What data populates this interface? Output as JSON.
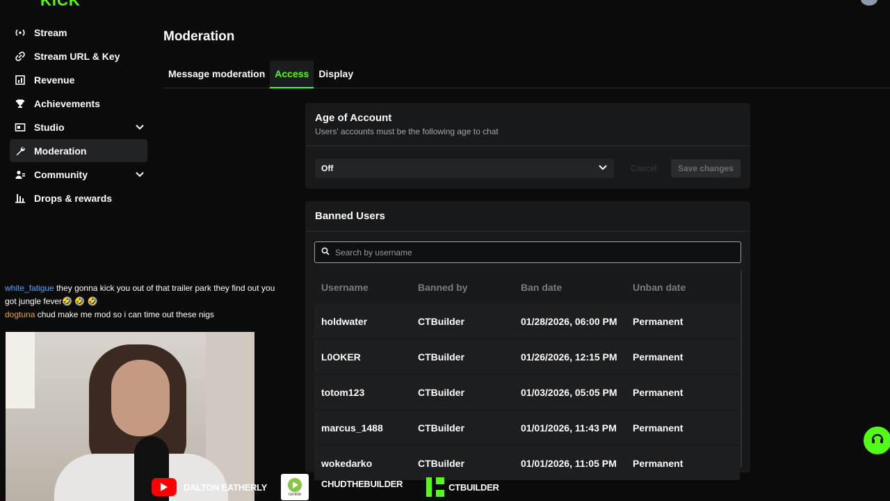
{
  "brand": {
    "logo_text": "KICK",
    "accent_color": "#53fc18"
  },
  "sidebar": {
    "items": [
      {
        "label": "Stream",
        "icon": "broadcast-icon"
      },
      {
        "label": "Stream URL & Key",
        "icon": "link-icon"
      },
      {
        "label": "Revenue",
        "icon": "chart-icon"
      },
      {
        "label": "Achievements",
        "icon": "trophy-icon"
      },
      {
        "label": "Studio",
        "icon": "studio-icon",
        "expandable": true
      },
      {
        "label": "Moderation",
        "icon": "wrench-icon",
        "active": true
      },
      {
        "label": "Community",
        "icon": "community-icon",
        "expandable": true
      },
      {
        "label": "Drops & rewards",
        "icon": "gift-icon"
      }
    ]
  },
  "page": {
    "title": "Moderation"
  },
  "tabs": [
    {
      "label": "Message moderation",
      "active": false
    },
    {
      "label": "Access",
      "active": true
    },
    {
      "label": "Display",
      "active": false
    }
  ],
  "age_card": {
    "title": "Age of Account",
    "subtitle": "Users' accounts must be the following age to chat",
    "selected_value": "Off",
    "cancel_label": "Cancel",
    "save_label": "Save changes"
  },
  "banned_card": {
    "title": "Banned Users",
    "search_placeholder": "Search by username",
    "columns": [
      "Username",
      "Banned by",
      "Ban date",
      "Unban date"
    ],
    "rows": [
      {
        "username": "holdwater",
        "banned_by": "CTBuilder",
        "ban_date": "01/28/2026, 06:00 PM",
        "unban_date": "Permanent"
      },
      {
        "username": "L0OKER",
        "banned_by": "CTBuilder",
        "ban_date": "01/26/2026, 12:15 PM",
        "unban_date": "Permanent"
      },
      {
        "username": "totom123",
        "banned_by": "CTBuilder",
        "ban_date": "01/03/2026, 05:05 PM",
        "unban_date": "Permanent"
      },
      {
        "username": "marcus_1488",
        "banned_by": "CTBuilder",
        "ban_date": "01/01/2026, 11:43 PM",
        "unban_date": "Permanent"
      },
      {
        "username": "wokedarko",
        "banned_by": "CTBuilder",
        "ban_date": "01/01/2026, 11:05 PM",
        "unban_date": "Permanent"
      }
    ]
  },
  "chat": [
    {
      "user": "white_fatigue",
      "message": "they gonna kick you out of that trailer park they find out you got jungle fever🤣 🤣 🤣",
      "color": "#4fa8ff"
    },
    {
      "user": "dogtuna",
      "message": "chud make me mod so i can time out these nigs",
      "color": "#f0a126"
    }
  ],
  "socials": {
    "youtube_handle": "DALTON EATHERLY",
    "rumble_label": "rumble",
    "rumble_handle": "CHUDTHEBUILDER",
    "kick_handle": "CTBUILDER"
  }
}
